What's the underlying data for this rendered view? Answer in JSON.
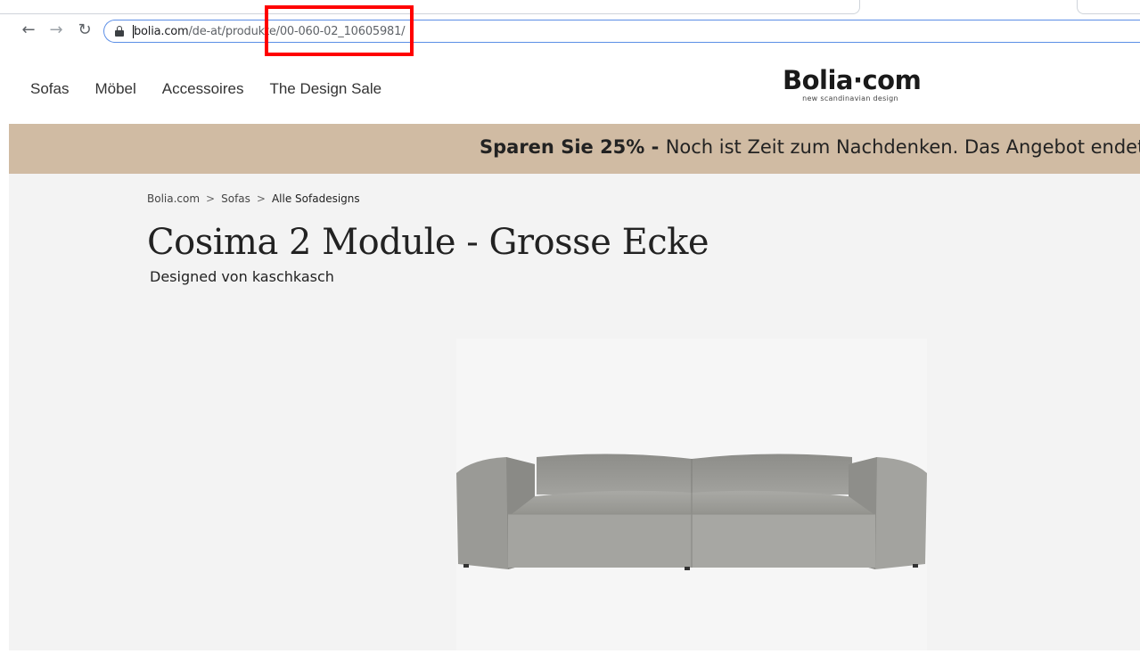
{
  "browser": {
    "back_icon": "arrow-left-icon",
    "forward_icon": "arrow-right-icon",
    "reload_icon": "reload-icon",
    "url_host": "bolia.com",
    "url_path": "/de-at/produkte/00-060-02_10605981/"
  },
  "site": {
    "nav": [
      "Sofas",
      "Möbel",
      "Accessoires",
      "The Design Sale"
    ],
    "logo_main": "Bolia·com",
    "logo_sub": "new scandinavian design"
  },
  "promo": {
    "strong": "Sparen Sie 25%",
    "dash": " - ",
    "text": "Noch ist Zeit zum Nachdenken. Das Angebot endet"
  },
  "breadcrumb": [
    "Bolia.com",
    "Sofas",
    "Alle Sofadesigns"
  ],
  "breadcrumb_separator": ">",
  "product": {
    "title": "Cosima 2 Module - Grosse Ecke",
    "designer": "Designed von kaschkasch"
  },
  "colors": {
    "promo_bg": "#d0bba3",
    "content_bg": "#f3f3f3",
    "sofa_fabric": "#9c9c98",
    "highlight": "#ff0000"
  }
}
